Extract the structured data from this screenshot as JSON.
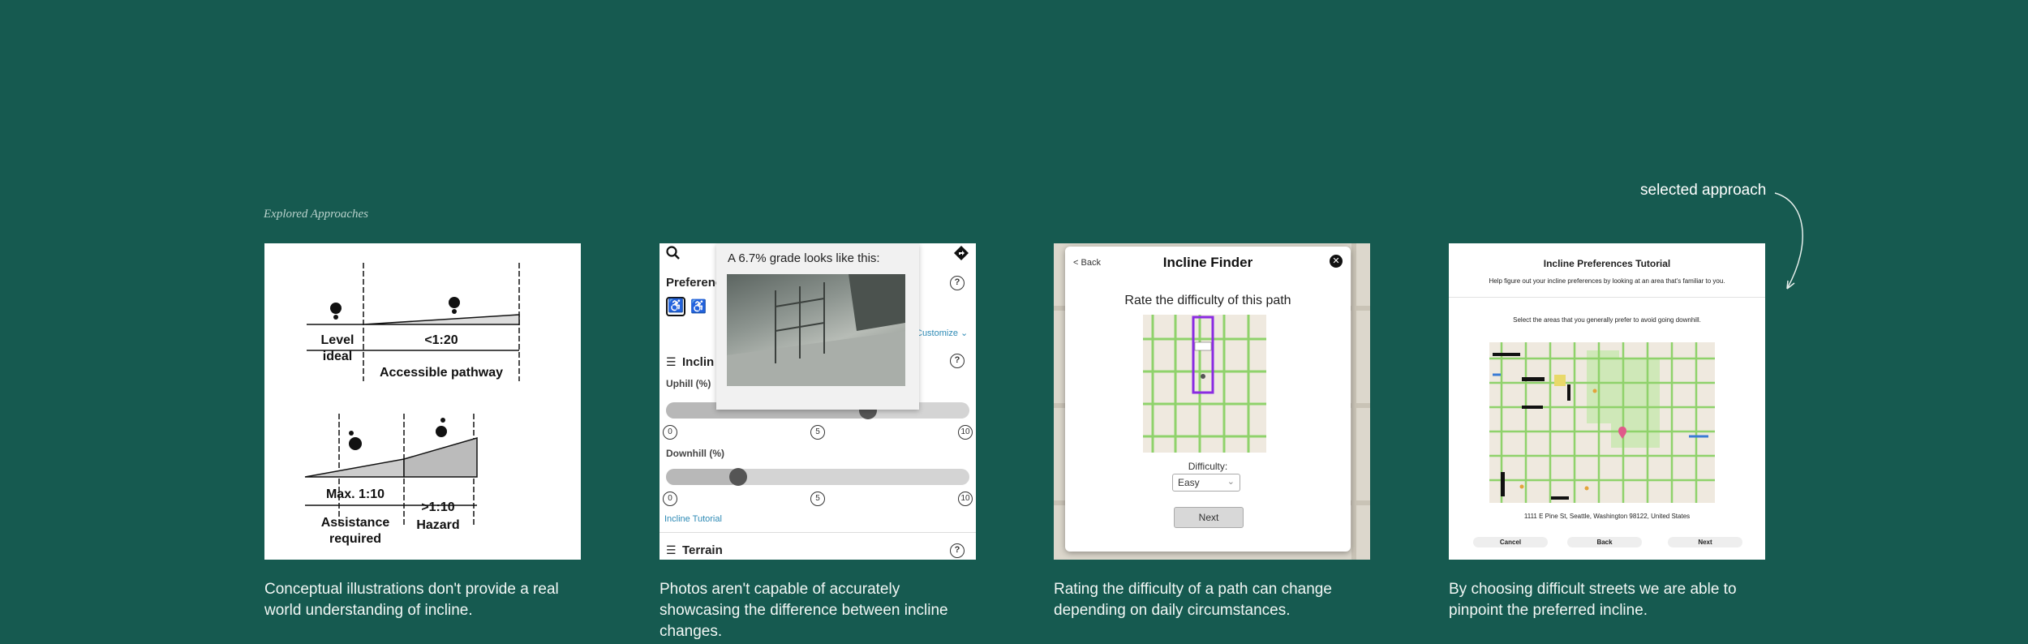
{
  "section_label": "Explored Approaches",
  "selected_label": "selected approach",
  "cards": [
    {
      "illustration": {
        "level_top": "Level",
        "level_bottom": "ideal",
        "ratio_1": "<1:20",
        "pathway": "Accessible pathway",
        "max_ratio": "Max. 1:10",
        "assist_1": "Assistance",
        "assist_2": "required",
        "hazard_ratio": ">1:10",
        "hazard": "Hazard"
      },
      "caption": "Conceptual illustrations don't provide a real world understanding of incline."
    },
    {
      "app": {
        "preferences": "Preferenc",
        "incline": "Inclin",
        "uphill": "Uphill (%)",
        "downhill": "Downhill (%)",
        "customize": "Customize",
        "tutorial": "Incline Tutorial",
        "terrain": "Terrain",
        "tick_min": "0",
        "tick_mid": "5",
        "tick_max": "10",
        "uphill_value": 6.7,
        "downhill_value": 2.3,
        "popup_title": "A 6.7% grade looks like this:"
      },
      "caption": "Photos aren't capable of accurately showcasing the difference between incline changes."
    },
    {
      "modal": {
        "back": "Back",
        "title": "Incline Finder",
        "prompt": "Rate the difficulty of this path",
        "difficulty_label": "Difficulty:",
        "difficulty_value": "Easy",
        "next": "Next"
      },
      "caption": "Rating the difficulty of a path can change depending on daily circumstances."
    },
    {
      "tutorial": {
        "title": "Incline Preferences Tutorial",
        "intro": "Help figure out your incline preferences by looking at an area that's familiar to you.",
        "instruction": "Select the areas that you generally prefer to avoid going downhill.",
        "address": "1111 E Pine St, Seattle, Washington 98122, United States",
        "cancel": "Cancel",
        "back": "Back",
        "next": "Next"
      },
      "caption": "By choosing difficult streets we are able to pinpoint the preferred incline."
    }
  ],
  "colors": {
    "background": "#165a50",
    "accent_purple": "#8a2be2",
    "link_blue": "#2d8ab5",
    "map_street_green": "#8fd26b"
  }
}
